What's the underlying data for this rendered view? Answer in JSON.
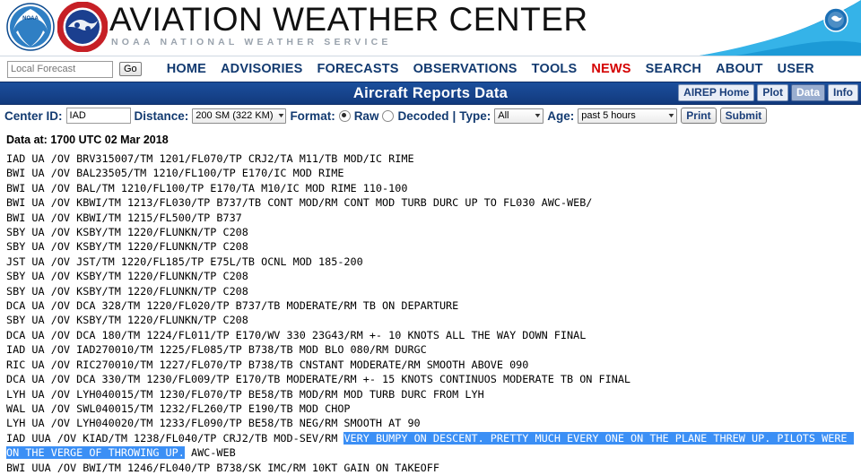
{
  "header": {
    "title": "AVIATION WEATHER CENTER",
    "subtitle": "NOAA   NATIONAL WEATHER SERVICE",
    "noaa_logo": "noaa-logo-icon",
    "nws_logo": "nws-logo-icon",
    "emblem": "nws-emblem-icon"
  },
  "nav": {
    "local_forecast_value": "",
    "local_forecast_placeholder": "Local Forecast",
    "go_label": "Go",
    "links": [
      {
        "label": "HOME",
        "highlight": false
      },
      {
        "label": "ADVISORIES",
        "highlight": false
      },
      {
        "label": "FORECASTS",
        "highlight": false
      },
      {
        "label": "OBSERVATIONS",
        "highlight": false
      },
      {
        "label": "TOOLS",
        "highlight": false
      },
      {
        "label": "NEWS",
        "highlight": true
      },
      {
        "label": "SEARCH",
        "highlight": false
      },
      {
        "label": "ABOUT",
        "highlight": false
      },
      {
        "label": "USER",
        "highlight": false
      }
    ]
  },
  "titlebar": {
    "title": "Aircraft Reports Data",
    "tabs": [
      {
        "label": "AIREP Home",
        "active": false
      },
      {
        "label": "Plot",
        "active": false
      },
      {
        "label": "Data",
        "active": true
      },
      {
        "label": "Info",
        "active": false
      }
    ]
  },
  "controls": {
    "center_id_label": "Center ID:",
    "center_id_value": "IAD",
    "distance_label": "Distance:",
    "distance_value": "200 SM (322 KM)",
    "format_label": "Format:",
    "format_raw_label": "Raw",
    "format_decoded_label": "Decoded",
    "format_selected": "Raw",
    "separator": "|",
    "type_label": "Type:",
    "type_value": "All",
    "age_label": "Age:",
    "age_value": "past 5 hours",
    "print_label": "Print",
    "submit_label": "Submit"
  },
  "data": {
    "data_at_label": "Data at: 1700 UTC 02 Mar 2018",
    "selection_color": "#3b8ff5",
    "reports": [
      {
        "text": "IAD UA /OV BRV315007/TM 1201/FL070/TP CRJ2/TA M11/TB MOD/IC RIME"
      },
      {
        "text": "BWI UA /OV BAL23505/TM 1210/FL100/TP E170/IC MOD RIME"
      },
      {
        "text": "BWI UA /OV BAL/TM 1210/FL100/TP E170/TA M10/IC MOD RIME 110-100"
      },
      {
        "text": "BWI UA /OV KBWI/TM 1213/FL030/TP B737/TB CONT MOD/RM CONT MOD TURB DURC UP TO FL030 AWC-WEB/"
      },
      {
        "text": "BWI UA /OV KBWI/TM 1215/FL500/TP B737"
      },
      {
        "text": "SBY UA /OV KSBY/TM 1220/FLUNKN/TP C208"
      },
      {
        "text": "SBY UA /OV KSBY/TM 1220/FLUNKN/TP C208"
      },
      {
        "text": "JST UA /OV JST/TM 1220/FL185/TP E75L/TB OCNL MOD 185-200"
      },
      {
        "text": "SBY UA /OV KSBY/TM 1220/FLUNKN/TP C208"
      },
      {
        "text": "SBY UA /OV KSBY/TM 1220/FLUNKN/TP C208"
      },
      {
        "text": "DCA UA /OV DCA 328/TM 1220/FL020/TP B737/TB MODERATE/RM TB ON DEPARTURE"
      },
      {
        "text": "SBY UA /OV KSBY/TM 1220/FLUNKN/TP C208"
      },
      {
        "text": "DCA UA /OV DCA 180/TM 1224/FL011/TP E170/WV 330 23G43/RM +- 10 KNOTS ALL THE WAY DOWN FINAL"
      },
      {
        "text": "IAD UA /OV IAD270010/TM 1225/FL085/TP B738/TB MOD BLO 080/RM DURGC"
      },
      {
        "text": "RIC UA /OV RIC270010/TM 1227/FL070/TP B738/TB CNSTANT MODERATE/RM SMOOTH ABOVE 090"
      },
      {
        "text": "DCA UA /OV DCA 330/TM 1230/FL009/TP E170/TB MODERATE/RM +- 15 KNOTS CONTINUOS MODERATE TB ON FINAL"
      },
      {
        "text": "LYH UA /OV LYH040015/TM 1230/FL070/TP BE58/TB MOD/RM MOD TURB DURC FROM LYH"
      },
      {
        "text": "WAL UA /OV SWL040015/TM 1232/FL260/TP E190/TB MOD CHOP"
      },
      {
        "text": "LYH UA /OV LYH040020/TM 1233/FL090/TP BE58/TB NEG/RM SMOOTH AT 90"
      },
      {
        "prefix": "IAD UUA /OV KIAD/TM 1238/FL040/TP CRJ2/TB MOD-SEV/RM ",
        "selected": "VERY BUMPY ON DESCENT. PRETTY MUCH EVERY ONE ON THE PLANE THREW UP. PILOTS WERE ON THE VERGE OF THROWING UP.",
        "suffix": " AWC-WEB"
      },
      {
        "text": "BWI UUA /OV BWI/TM 1246/FL040/TP B738/SK IMC/RM 10KT GAIN ON TAKEOFF"
      }
    ]
  }
}
